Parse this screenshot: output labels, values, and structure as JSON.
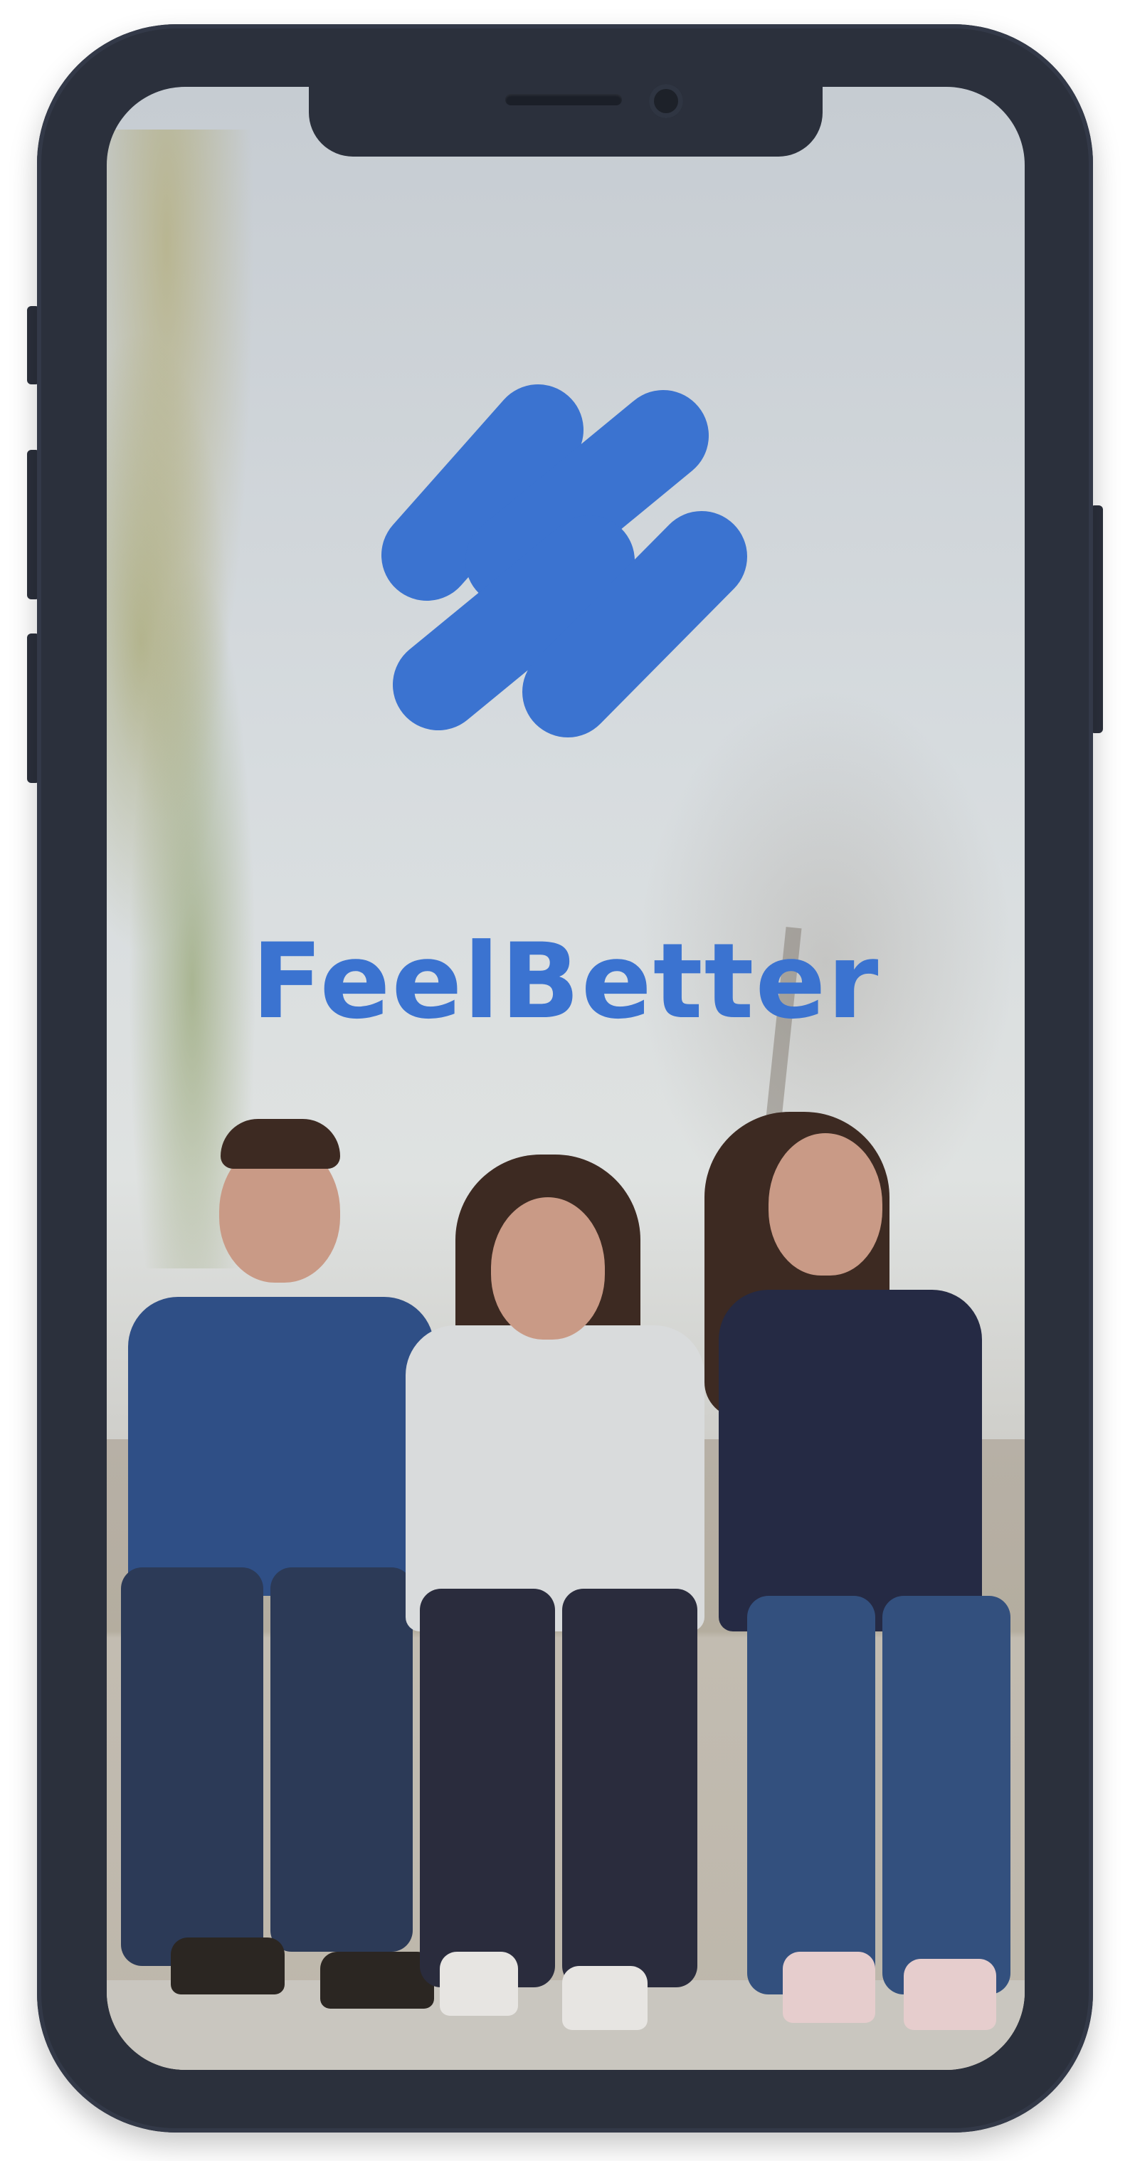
{
  "app": {
    "title": "FeelBetter",
    "brand_color": "#3b73d0"
  },
  "icons": {
    "logo": "feelbetter-logo-icon"
  },
  "device": {
    "frame_color": "#2b303c"
  }
}
